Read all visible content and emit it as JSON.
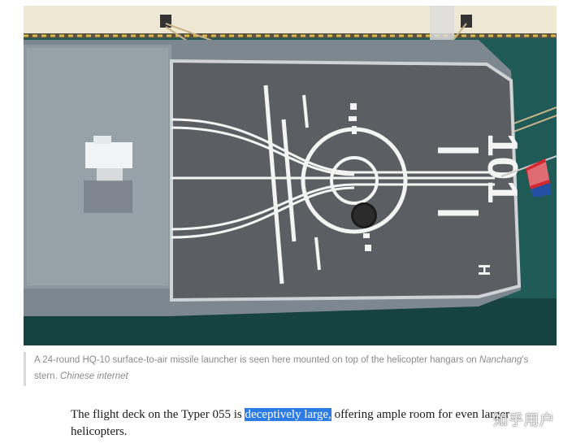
{
  "photo": {
    "hull_number": "101",
    "deck_letter": "H",
    "colors": {
      "water": "#1f5a57",
      "pier": "#efe8d5",
      "deck": "#5b5f63",
      "hull": "#7d8790",
      "hangar_roof": "#8e989f",
      "markings": "#f4f4f2",
      "flag": "#d6262f"
    }
  },
  "caption": {
    "text_before": "A 24-round HQ-10 surface-to-air missile launcher is seen here mounted on top of the helicopter hangars on ",
    "ship_name": "Nanchang",
    "text_after": "'s stern. ",
    "credit": "Chinese internet"
  },
  "article": {
    "text_before": "The flight deck on the Typer 055 is ",
    "highlighted": "deceptively large,",
    "text_after": " offering ample room for even larger helicopters."
  },
  "watermark": "知乎用户"
}
